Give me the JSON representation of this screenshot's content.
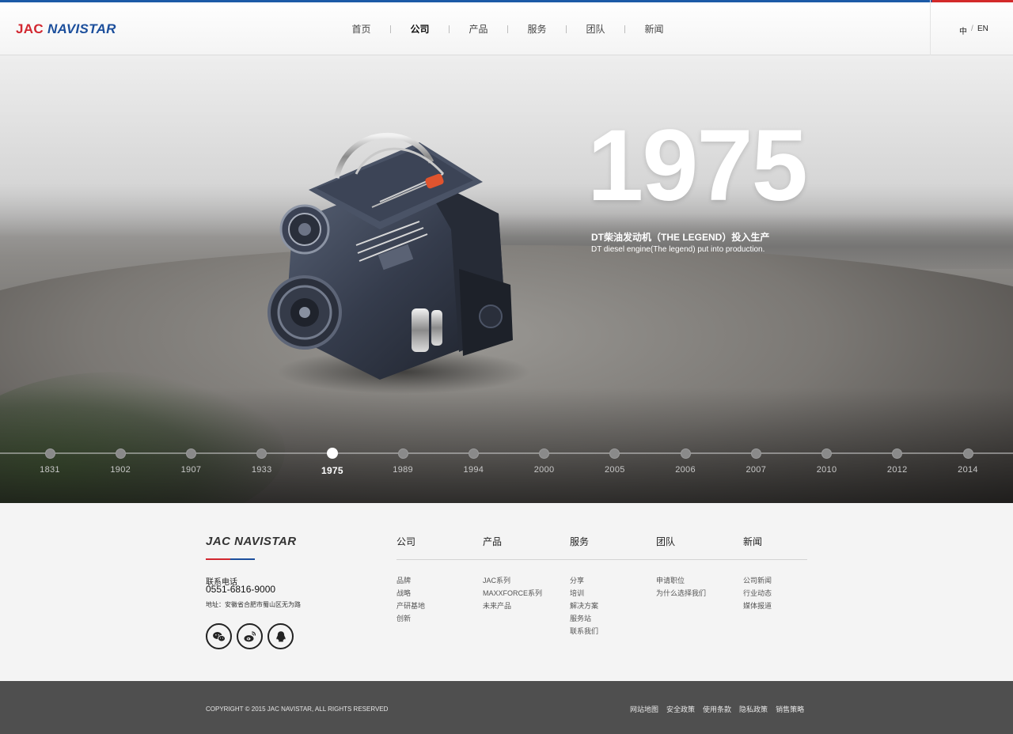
{
  "header": {
    "logo_left": "JAC",
    "logo_right": "NAVISTAR",
    "nav": [
      "首页",
      "公司",
      "产品",
      "服务",
      "团队",
      "新闻"
    ],
    "active_nav": "公司",
    "lang_cn": "中",
    "lang_sep": "/",
    "lang_en": "EN"
  },
  "hero": {
    "year": "1975",
    "caption_cn": "DT柴油发动机（THE LEGEND）投入生产",
    "caption_en": "DT diesel engine(The legend) put into production.",
    "timeline": [
      "1831",
      "1902",
      "1907",
      "1933",
      "1975",
      "1989",
      "1994",
      "2000",
      "2005",
      "2006",
      "2007",
      "2010",
      "2012",
      "2014"
    ],
    "active_year": "1975"
  },
  "footer": {
    "logo": "JAC NAVISTAR",
    "phone_label": "联系电话",
    "phone": "0551-6816-9000",
    "address": "地址：安徽省合肥市蜀山区无为路",
    "columns": [
      {
        "title": "公司",
        "links": [
          "品牌",
          "战略",
          "产研基地",
          "创新"
        ]
      },
      {
        "title": "产品",
        "links": [
          "JAC系列",
          "MAXXFORCE系列",
          "未来产品"
        ]
      },
      {
        "title": "服务",
        "links": [
          "分享",
          "培训",
          "解决方案",
          "服务站",
          "联系我们"
        ]
      },
      {
        "title": "团队",
        "links": [
          "申请职位",
          "为什么选择我们"
        ]
      },
      {
        "title": "新闻",
        "links": [
          "公司新闻",
          "行业动态",
          "媒体报道"
        ]
      }
    ],
    "social": [
      "wechat-icon",
      "weibo-icon",
      "qq-icon"
    ]
  },
  "bottom": {
    "copyright": "COPYRIGHT © 2015 JAC NAVISTAR, ALL RIGHTS RESERVED",
    "links": [
      "网站地图",
      "安全政策",
      "使用条款",
      "隐私政策",
      "销售策略"
    ]
  },
  "colors": {
    "brand_red": "#d22730",
    "brand_blue": "#1c4f9c",
    "footer_bottom": "#4f4f4f"
  }
}
